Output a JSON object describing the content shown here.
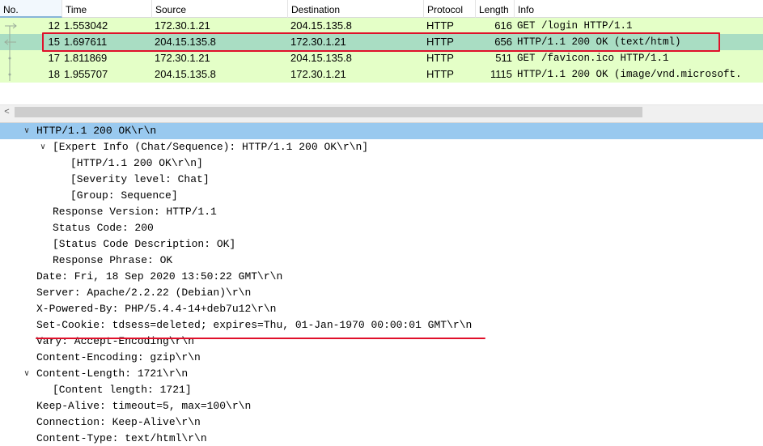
{
  "packet_list": {
    "columns": [
      "No.",
      "Time",
      "Source",
      "Destination",
      "Protocol",
      "Length",
      "Info"
    ],
    "rows": [
      {
        "no": "12",
        "time": "1.553042",
        "source": "172.30.1.21",
        "destination": "204.15.135.8",
        "protocol": "HTTP",
        "length": "616",
        "info": "GET /login HTTP/1.1"
      },
      {
        "no": "15",
        "time": "1.697611",
        "source": "204.15.135.8",
        "destination": "172.30.1.21",
        "protocol": "HTTP",
        "length": "656",
        "info": "HTTP/1.1 200 OK  (text/html)"
      },
      {
        "no": "17",
        "time": "1.811869",
        "source": "172.30.1.21",
        "destination": "204.15.135.8",
        "protocol": "HTTP",
        "length": "511",
        "info": "GET /favicon.ico HTTP/1.1"
      },
      {
        "no": "18",
        "time": "1.955707",
        "source": "204.15.135.8",
        "destination": "172.30.1.21",
        "protocol": "HTTP",
        "length": "1115",
        "info": "HTTP/1.1 200 OK  (image/vnd.microsoft."
      }
    ],
    "selected_row": 1
  },
  "scrollbar": {
    "left_arrow": "<"
  },
  "details": {
    "lines": [
      {
        "text": "HTTP/1.1 200 OK\\r\\n",
        "expander": "∨"
      },
      {
        "text": "[Expert Info (Chat/Sequence): HTTP/1.1 200 OK\\r\\n]",
        "expander": "∨"
      },
      {
        "text": "[HTTP/1.1 200 OK\\r\\n]",
        "expander": ""
      },
      {
        "text": "[Severity level: Chat]",
        "expander": ""
      },
      {
        "text": "[Group: Sequence]",
        "expander": ""
      },
      {
        "text": "Response Version: HTTP/1.1",
        "expander": ""
      },
      {
        "text": "Status Code: 200",
        "expander": ""
      },
      {
        "text": "[Status Code Description: OK]",
        "expander": ""
      },
      {
        "text": "Response Phrase: OK",
        "expander": ""
      },
      {
        "text": "Date: Fri, 18 Sep 2020 13:50:22 GMT\\r\\n",
        "expander": ""
      },
      {
        "text": "Server: Apache/2.2.22 (Debian)\\r\\n",
        "expander": ""
      },
      {
        "text": "X-Powered-By: PHP/5.4.4-14+deb7u12\\r\\n",
        "expander": ""
      },
      {
        "text": "Set-Cookie: tdsess=deleted; expires=Thu, 01-Jan-1970 00:00:01 GMT\\r\\n",
        "expander": ""
      },
      {
        "text": "Vary: Accept-Encoding\\r\\n",
        "expander": ""
      },
      {
        "text": "Content-Encoding: gzip\\r\\n",
        "expander": ""
      },
      {
        "text": "Content-Length: 1721\\r\\n",
        "expander": "∨"
      },
      {
        "text": "[Content length: 1721]",
        "expander": ""
      },
      {
        "text": "Keep-Alive: timeout=5, max=100\\r\\n",
        "expander": ""
      },
      {
        "text": "Connection: Keep-Alive\\r\\n",
        "expander": ""
      },
      {
        "text": "Content-Type: text/html\\r\\n",
        "expander": ""
      }
    ]
  },
  "colors": {
    "http_row": "#e4ffc7",
    "selected_row": "#a9ddc3",
    "tree_selected": "#99c9ef",
    "annotation_red": "#e0102a"
  }
}
